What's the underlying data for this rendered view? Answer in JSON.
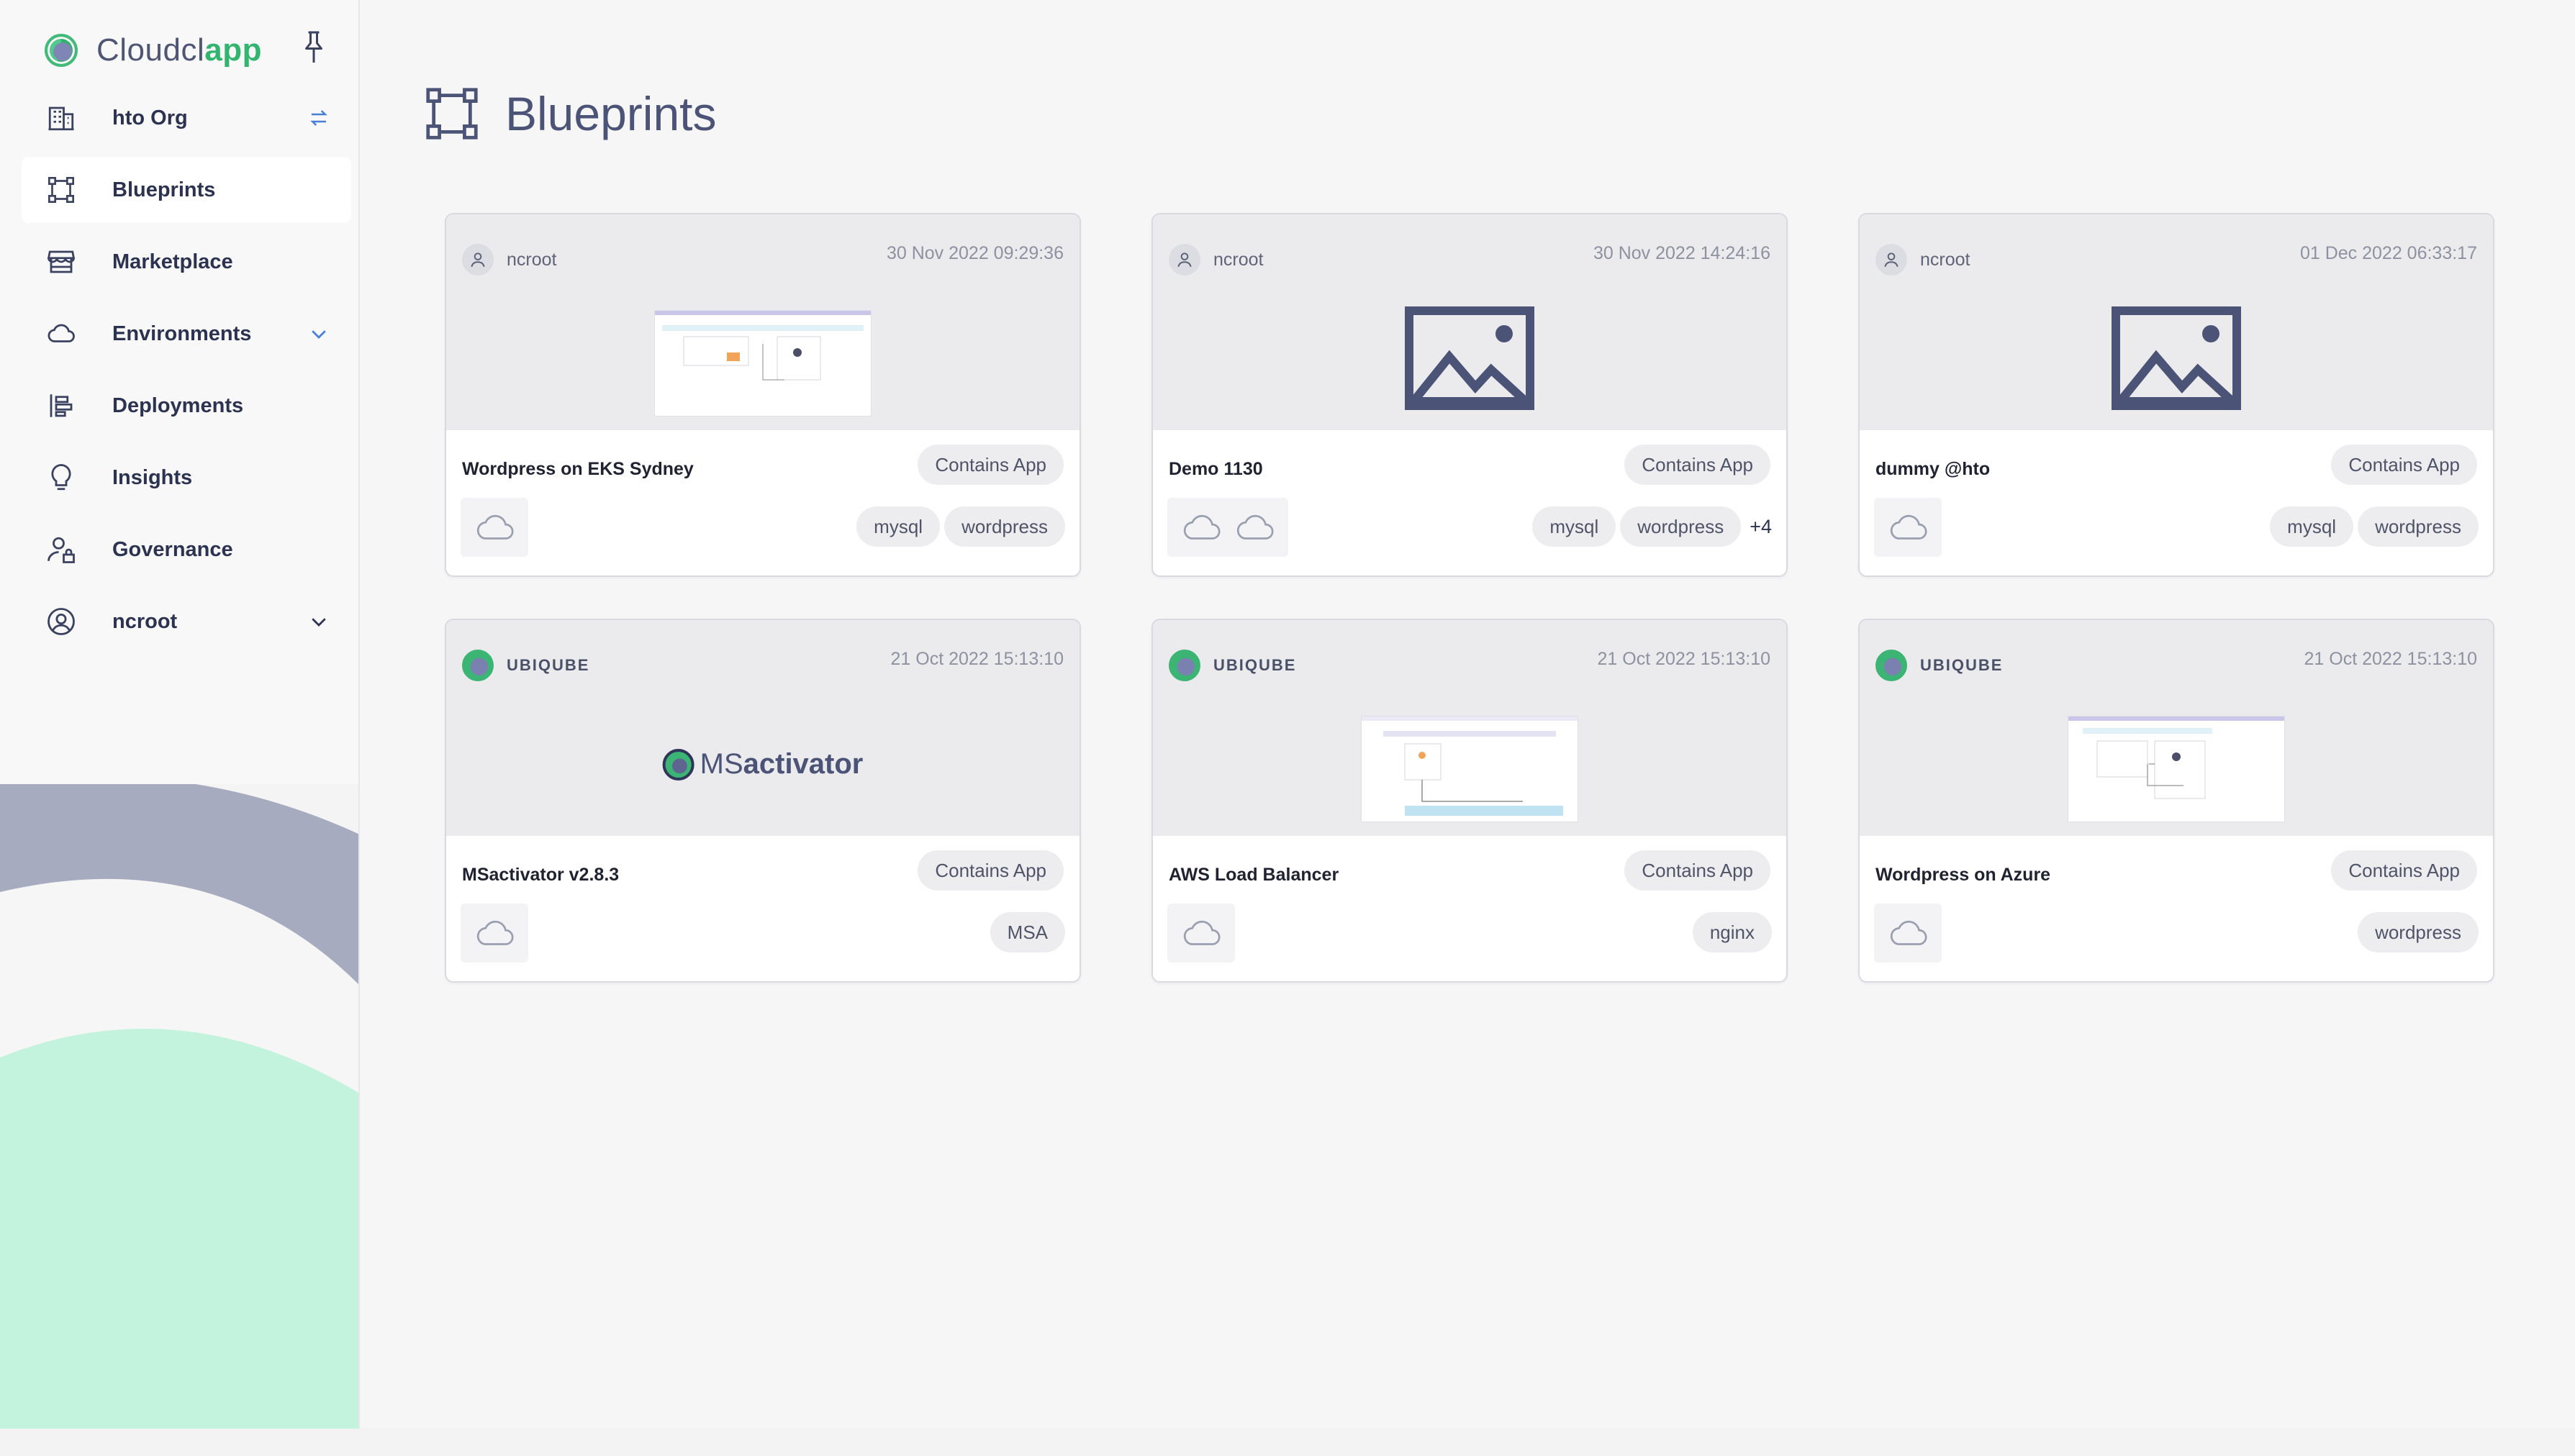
{
  "app": {
    "name_prefix": "Cloudcl",
    "name_accent": "app"
  },
  "sidebar": {
    "items": [
      {
        "label": "hto Org",
        "icon": "building-icon",
        "right": "switch-icon"
      },
      {
        "label": "Blueprints",
        "icon": "blueprint-icon",
        "active": true
      },
      {
        "label": "Marketplace",
        "icon": "store-icon"
      },
      {
        "label": "Environments",
        "icon": "cloud-icon",
        "right": "chevron-down-icon"
      },
      {
        "label": "Deployments",
        "icon": "deployments-icon"
      },
      {
        "label": "Insights",
        "icon": "lightbulb-icon"
      },
      {
        "label": "Governance",
        "icon": "user-lock-icon"
      },
      {
        "label": "ncroot",
        "icon": "user-circle-icon",
        "right": "chevron-down-icon"
      }
    ]
  },
  "page": {
    "title": "Blueprints"
  },
  "cards": [
    {
      "owner": "ncroot",
      "date": "30 Nov 2022 09:29:36",
      "name": "Wordpress on EKS Sydney",
      "badge": "Contains App",
      "tags": [
        "mysql",
        "wordpress"
      ],
      "more": "",
      "clouds": 1,
      "thumb": "screenshot"
    },
    {
      "owner": "ncroot",
      "date": "30 Nov 2022 14:24:16",
      "name": "Demo 1130",
      "badge": "Contains App",
      "tags": [
        "mysql",
        "wordpress"
      ],
      "more": "+4",
      "clouds": 2,
      "thumb": "image-placeholder"
    },
    {
      "owner": "ncroot",
      "date": "01 Dec 2022 06:33:17",
      "name": "dummy @hto",
      "badge": "Contains App",
      "tags": [
        "mysql",
        "wordpress"
      ],
      "more": "",
      "clouds": 1,
      "thumb": "image-placeholder"
    },
    {
      "owner": "UBIQUBE",
      "date": "21 Oct 2022 15:13:10",
      "name": "MSactivator v2.8.3",
      "badge": "Contains App",
      "tags": [
        "MSA"
      ],
      "more": "",
      "clouds": 1,
      "thumb": "msactivator-logo",
      "thumb_text_a": "MS",
      "thumb_text_b": "activator"
    },
    {
      "owner": "UBIQUBE",
      "date": "21 Oct 2022 15:13:10",
      "name": "AWS Load Balancer",
      "badge": "Contains App",
      "tags": [
        "nginx"
      ],
      "more": "",
      "clouds": 1,
      "thumb": "screenshot"
    },
    {
      "owner": "UBIQUBE",
      "date": "21 Oct 2022 15:13:10",
      "name": "Wordpress on Azure",
      "badge": "Contains App",
      "tags": [
        "wordpress"
      ],
      "more": "",
      "clouds": 1,
      "thumb": "screenshot"
    }
  ]
}
